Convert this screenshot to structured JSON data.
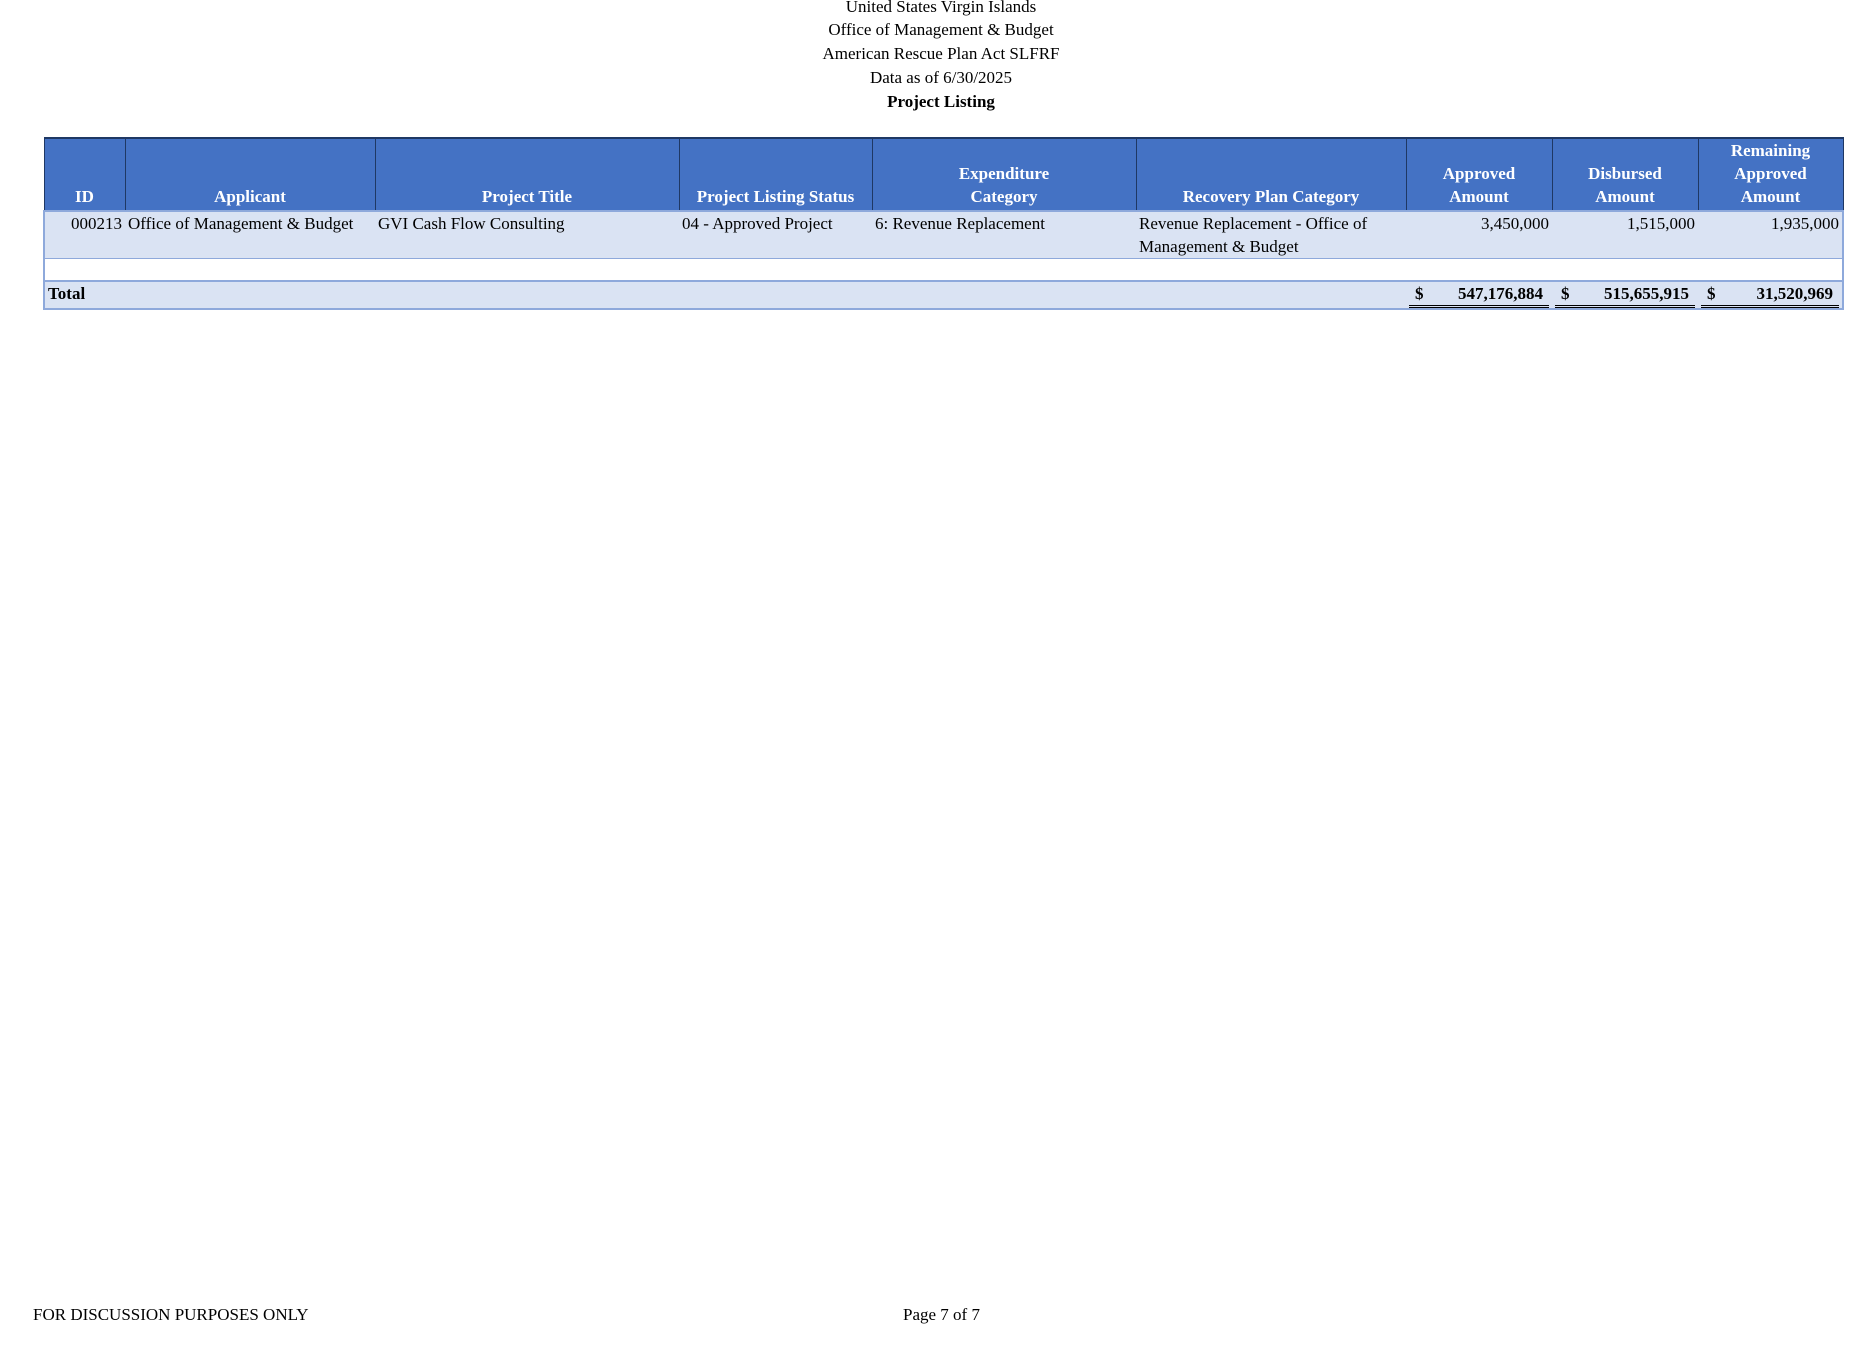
{
  "header": {
    "line1": "United States Virgin Islands",
    "line2": "Office of Management & Budget",
    "line3": "American Rescue Plan Act SLFRF",
    "line4": "Data as of 6/30/2025",
    "title": "Project Listing"
  },
  "columns": {
    "id": "ID",
    "applicant": "Applicant",
    "project_title": "Project Title",
    "status": "Project Listing Status",
    "expenditure_1": "Expenditure",
    "expenditure_2": "Category",
    "recovery": "Recovery Plan Category",
    "approved_1": "Approved",
    "approved_2": "Amount",
    "disbursed_1": "Disbursed",
    "disbursed_2": "Amount",
    "remaining_1": "Remaining",
    "remaining_2": "Approved",
    "remaining_3": "Amount"
  },
  "rows": [
    {
      "id": "000213",
      "applicant": "Office of Management & Budget",
      "project_title": "GVI Cash Flow Consulting",
      "status": "04 - Approved Project",
      "expenditure": "6: Revenue Replacement",
      "recovery_1": "Revenue Replacement - Office of",
      "recovery_2": "Management & Budget",
      "approved": "3,450,000",
      "disbursed": "1,515,000",
      "remaining": "1,935,000"
    }
  ],
  "total": {
    "label": "Total",
    "currency": "$",
    "approved": "547,176,884",
    "disbursed": "515,655,915",
    "remaining": "31,520,969"
  },
  "footer": {
    "left": "FOR DISCUSSION PURPOSES ONLY",
    "page": "Page 7 of 7"
  }
}
